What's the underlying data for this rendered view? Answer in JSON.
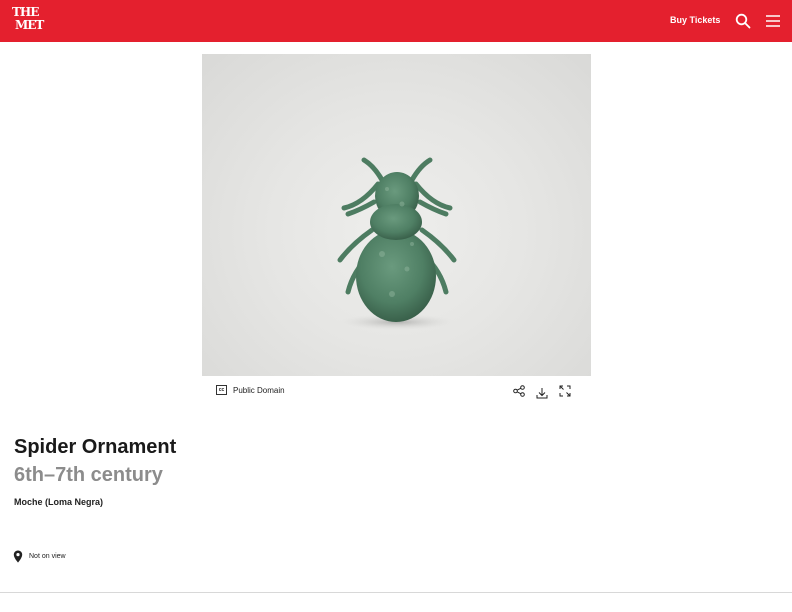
{
  "header": {
    "logo_line1": "THE",
    "logo_line2": "MET",
    "buy_tickets": "Buy Tickets",
    "brand_color": "#e4202e"
  },
  "image_toolbar": {
    "license_badge": "cc",
    "license_label": "Public Domain",
    "icons": [
      "share-icon",
      "download-icon",
      "fullscreen-icon"
    ]
  },
  "object": {
    "title": "Spider Ornament",
    "date": "6th–7th century",
    "culture": "Moche (Loma Negra)",
    "view_status": "Not on view"
  }
}
